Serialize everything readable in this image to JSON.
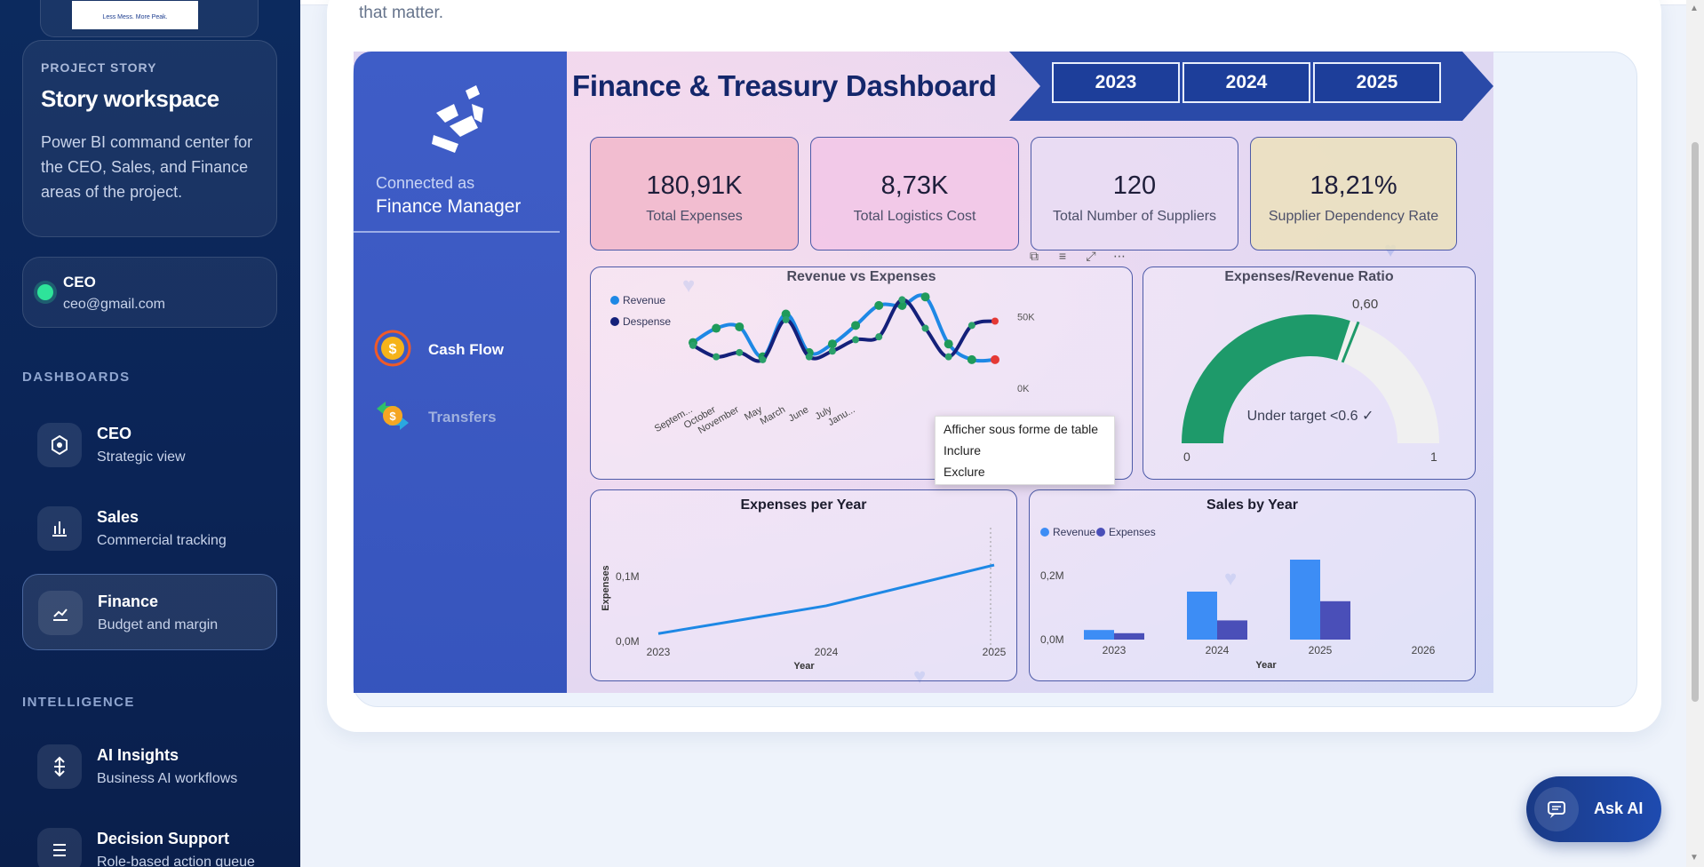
{
  "sidebar": {
    "logo_text": "Less Mess. More Peak.",
    "story": {
      "kicker": "PROJECT STORY",
      "title": "Story workspace",
      "description": "Power BI command center for the CEO, Sales, and Finance areas of the project."
    },
    "user": {
      "name": "CEO",
      "email": "ceo@gmail.com",
      "status_color": "#2ee39a"
    },
    "sections": {
      "dashboards": "DASHBOARDS",
      "intelligence": "INTELLIGENCE"
    },
    "dashboards": [
      {
        "title": "CEO",
        "subtitle": "Strategic view",
        "icon": "target-icon"
      },
      {
        "title": "Sales",
        "subtitle": "Commercial tracking",
        "icon": "bar-chart-icon"
      },
      {
        "title": "Finance",
        "subtitle": "Budget and margin",
        "icon": "trend-icon",
        "active": true
      }
    ],
    "intelligence": [
      {
        "title": "AI Insights",
        "subtitle": "Business AI workflows",
        "icon": "ai-arrows-icon"
      },
      {
        "title": "Decision Support",
        "subtitle": "Role-based action queue",
        "icon": "list-icon"
      }
    ]
  },
  "main": {
    "intro_tail": "that matter."
  },
  "report": {
    "connected_label": "Connected as",
    "connected_role": "Finance Manager",
    "pages": [
      {
        "label": "Cash Flow",
        "icon": "cash-flow-icon"
      },
      {
        "label": "Transfers",
        "icon": "transfers-icon"
      }
    ],
    "title": "Finance & Treasury Dashboard",
    "years": [
      "2023",
      "2024",
      "2025"
    ],
    "kpis": [
      {
        "value": "180,91K",
        "label": "Total Expenses",
        "bg": "#f1b5c8"
      },
      {
        "value": "8,73K",
        "label": "Total Logistics Cost",
        "bg": "#f2c4e6"
      },
      {
        "value": "120",
        "label": "Total Number of Suppliers",
        "bg": "#e8dcf4"
      },
      {
        "value": "18,21%",
        "label": "Supplier Dependency Rate",
        "bg": "#ece2b8"
      }
    ],
    "context_menu": [
      "Afficher sous forme de table",
      "Inclure",
      "Exclure"
    ]
  },
  "ask_ai_label": "Ask AI",
  "chart_data": [
    {
      "type": "line",
      "title": "Revenue vs Expenses",
      "categories": [
        "Septem...",
        "October",
        "November",
        "May",
        "March",
        "June",
        "July",
        "Janu...",
        "",
        "",
        "",
        "",
        "",
        "",
        ""
      ],
      "y_ticks": [
        "50K",
        "0K"
      ],
      "series": [
        {
          "name": "Revenue",
          "color": "#1e88e5",
          "values": [
            32,
            42,
            43,
            22,
            52,
            25,
            31,
            44,
            58,
            58,
            64,
            31,
            20,
            20
          ]
        },
        {
          "name": "Despense",
          "color": "#14207a",
          "values": [
            30,
            22,
            25,
            20,
            48,
            22,
            26,
            34,
            36,
            62,
            42,
            22,
            44,
            47
          ]
        }
      ]
    },
    {
      "type": "gauge",
      "title": "Expenses/Revenue Ratio",
      "min": 0,
      "max": 1,
      "value": 0.6,
      "min_label": "0",
      "max_label": "1",
      "target_label": "0,60",
      "note": "Under target <0.6 ✓",
      "fill_color": "#1e9a6a"
    },
    {
      "type": "line",
      "title": "Expenses per Year",
      "xlabel": "Year",
      "ylabel": "Expenses",
      "categories": [
        "2023",
        "2024",
        "2025"
      ],
      "y_ticks": [
        "0,1M",
        "0,0M"
      ],
      "series": [
        {
          "name": "Expenses",
          "color": "#1e88e5",
          "values": [
            0.012,
            0.055,
            0.118
          ]
        }
      ]
    },
    {
      "type": "bar",
      "title": "Sales by Year",
      "xlabel": "Year",
      "categories": [
        "2023",
        "2024",
        "2025",
        "2026"
      ],
      "y_ticks": [
        "0,2M",
        "0,0M"
      ],
      "series": [
        {
          "name": "Revenue",
          "color": "#3d8df5",
          "values": [
            0.03,
            0.15,
            0.25,
            0
          ]
        },
        {
          "name": "Expenses",
          "color": "#4a4fb8",
          "values": [
            0.02,
            0.06,
            0.12,
            0
          ]
        }
      ]
    }
  ]
}
